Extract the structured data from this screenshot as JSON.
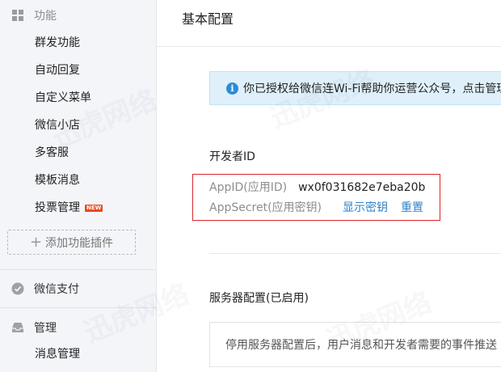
{
  "sidebar": {
    "features_header": "功能",
    "features_items": [
      {
        "label": "群发功能"
      },
      {
        "label": "自动回复"
      },
      {
        "label": "自定义菜单"
      },
      {
        "label": "微信小店"
      },
      {
        "label": "多客服"
      },
      {
        "label": "模板消息"
      },
      {
        "label": "投票管理",
        "badge": "NEW"
      }
    ],
    "add_plugin_label": "添加功能插件",
    "pay_header": "微信支付",
    "manage_header": "管理",
    "manage_items": [
      {
        "label": "消息管理"
      }
    ]
  },
  "main": {
    "title": "基本配置",
    "notice_text": "你已授权给微信连Wi-Fi帮助你运营公众号，点击管理",
    "developer": {
      "section_title": "开发者ID",
      "appid_label": "AppID(应用ID)",
      "appid_value": "wx0f031682e7eba20b",
      "secret_label": "AppSecret(应用密钥)",
      "show_secret": "显示密钥",
      "reset": "重置"
    },
    "server": {
      "section_title": "服务器配置(已启用)",
      "description": "停用服务器配置后，用户消息和开发者需要的事件推送"
    }
  },
  "watermark": "迅虎网络",
  "colors": {
    "accent": "#2f82c9",
    "highlight_border": "#d9262b",
    "notice_bg": "#dff0fa",
    "badge": "#e84b1e"
  }
}
